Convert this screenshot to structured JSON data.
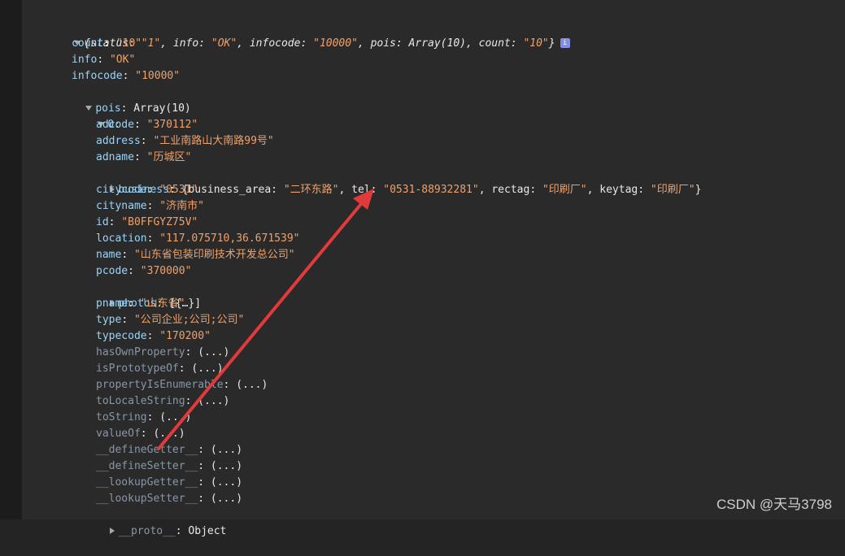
{
  "header": {
    "open": "{",
    "status_key": "status",
    "status_val": "\"1\"",
    "info_key": "info",
    "info_val": "\"OK\"",
    "infocode_key": "infocode",
    "infocode_val": "\"10000\"",
    "pois_key": "pois",
    "pois_val": "Array(10)",
    "count_key": "count",
    "count_val": "\"10\"",
    "close": "}",
    "badge": "i"
  },
  "root_props": [
    {
      "key": "count",
      "val": "\"10\""
    },
    {
      "key": "info",
      "val": "\"OK\""
    },
    {
      "key": "infocode",
      "val": "\"10000\""
    }
  ],
  "pois": {
    "key": "pois",
    "val": "Array(10)"
  },
  "item0": {
    "key": "0"
  },
  "item_props": [
    {
      "key": "adcode",
      "val": "\"370112\""
    },
    {
      "key": "address",
      "val": "\"工业南路山大南路99号\""
    },
    {
      "key": "adname",
      "val": "\"历城区\""
    }
  ],
  "business": {
    "key": "business",
    "open": "{",
    "business_area_key": "business_area",
    "business_area_val": "\"二环东路\"",
    "tel_key": "tel",
    "tel_val": "\"0531-88932281\"",
    "rectag_key": "rectag",
    "rectag_val": "\"印刷厂\"",
    "keytag_key": "keytag",
    "keytag_val": "\"印刷厂\"",
    "close": "}"
  },
  "item_props2": [
    {
      "key": "citycode",
      "val": "\"0531\""
    },
    {
      "key": "cityname",
      "val": "\"济南市\""
    },
    {
      "key": "id",
      "val": "\"B0FFGYZ75V\""
    },
    {
      "key": "location",
      "val": "\"117.075710,36.671539\""
    },
    {
      "key": "name",
      "val": "\"山东省包装印刷技术开发总公司\""
    },
    {
      "key": "pcode",
      "val": "\"370000\""
    }
  ],
  "photos": {
    "key": "photos",
    "val": "[{…}]"
  },
  "item_props3": [
    {
      "key": "pname",
      "val": "\"山东省\""
    },
    {
      "key": "type",
      "val": "\"公司企业;公司;公司\""
    },
    {
      "key": "typecode",
      "val": "\"170200\""
    }
  ],
  "proto_methods": [
    {
      "key": "hasOwnProperty",
      "val": "(...)"
    },
    {
      "key": "isPrototypeOf",
      "val": "(...)"
    },
    {
      "key": "propertyIsEnumerable",
      "val": "(...)"
    },
    {
      "key": "toLocaleString",
      "val": "(...)"
    },
    {
      "key": "toString",
      "val": "(...)"
    },
    {
      "key": "valueOf",
      "val": "(...)"
    },
    {
      "key": "__defineGetter__",
      "val": "(...)"
    },
    {
      "key": "__defineSetter__",
      "val": "(...)"
    },
    {
      "key": "__lookupGetter__",
      "val": "(...)"
    },
    {
      "key": "__lookupSetter__",
      "val": "(...)"
    }
  ],
  "proto": {
    "key": "__proto__",
    "val": "Object"
  },
  "watermark": "CSDN @天马3798",
  "arrow_color": "#e23a3a"
}
